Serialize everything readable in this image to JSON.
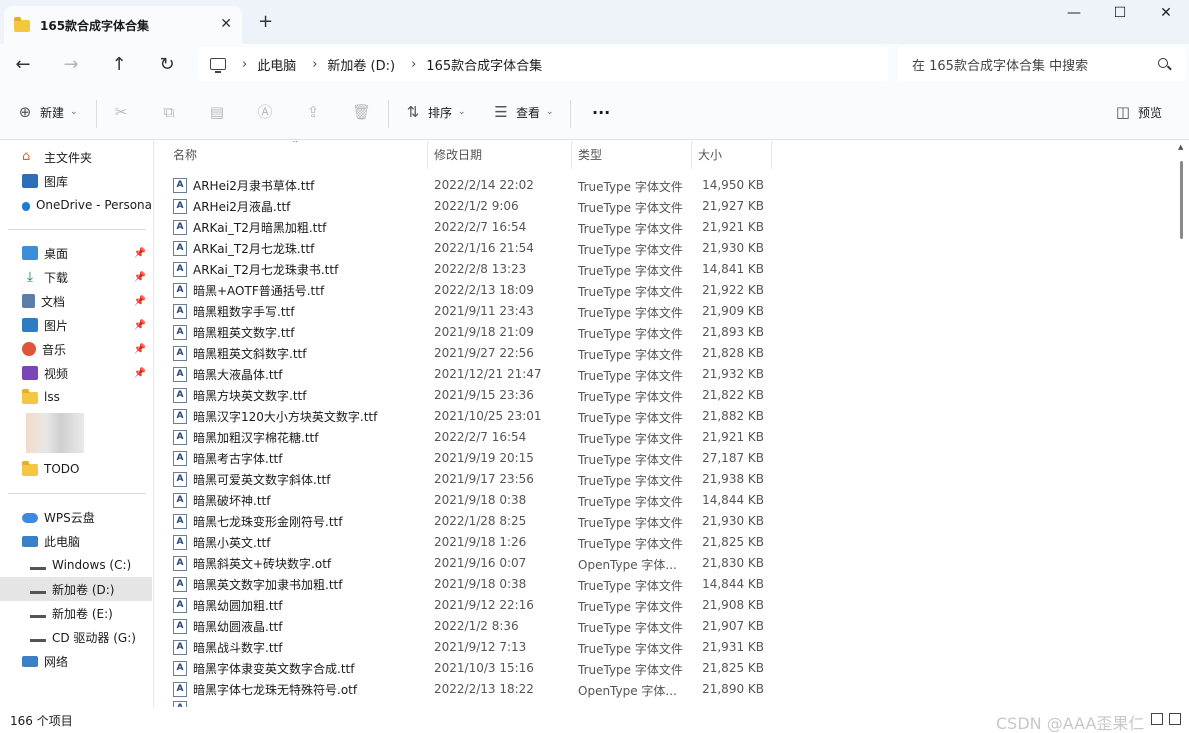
{
  "window": {
    "tab_title": "165款合成字体合集",
    "tab_close": "✕",
    "new_tab": "+",
    "minimize": "—",
    "maximize": "☐",
    "close": "✕"
  },
  "address": {
    "breadcrumbs": [
      "此电脑",
      "新加卷 (D:)",
      "165款合成字体合集"
    ],
    "search_placeholder": "在 165款合成字体合集 中搜索"
  },
  "toolbar": {
    "new_label": "新建",
    "sort_label": "排序",
    "view_label": "查看",
    "more_label": "···",
    "preview_label": "预览"
  },
  "sidebar": {
    "items": [
      {
        "label": "主文件夹",
        "icon": "home-icon"
      },
      {
        "label": "图库",
        "icon": "gallery-icon"
      },
      {
        "label": "OneDrive - Persona",
        "icon": "onedrive-icon"
      },
      {
        "label": "桌面",
        "icon": "desktop-icon",
        "pinned": true
      },
      {
        "label": "下载",
        "icon": "download-icon",
        "pinned": true
      },
      {
        "label": "文档",
        "icon": "documents-icon",
        "pinned": true
      },
      {
        "label": "图片",
        "icon": "pictures-icon",
        "pinned": true
      },
      {
        "label": "音乐",
        "icon": "music-icon",
        "pinned": true
      },
      {
        "label": "视频",
        "icon": "videos-icon",
        "pinned": true
      },
      {
        "label": "lss",
        "icon": "folder-icon"
      },
      {
        "label": "TODO",
        "icon": "folder-icon"
      },
      {
        "label": "WPS云盘",
        "icon": "wps-cloud-icon"
      },
      {
        "label": "此电脑",
        "icon": "pc-icon"
      },
      {
        "label": "Windows (C:)",
        "icon": "drive-icon"
      },
      {
        "label": "新加卷 (D:)",
        "icon": "drive-icon",
        "selected": true
      },
      {
        "label": "新加卷 (E:)",
        "icon": "drive-icon"
      },
      {
        "label": "CD 驱动器 (G:)",
        "icon": "cd-drive-icon"
      },
      {
        "label": "网络",
        "icon": "network-icon"
      }
    ]
  },
  "columns": {
    "name": "名称",
    "date": "修改日期",
    "type": "类型",
    "size": "大小"
  },
  "files": [
    {
      "name": "ARHei2月隶书草体.ttf",
      "date": "2022/2/14 22:02",
      "type": "TrueType 字体文件",
      "size": "14,950 KB"
    },
    {
      "name": "ARHei2月液晶.ttf",
      "date": "2022/1/2 9:06",
      "type": "TrueType 字体文件",
      "size": "21,927 KB"
    },
    {
      "name": "ARKai_T2月暗黑加粗.ttf",
      "date": "2022/2/7 16:54",
      "type": "TrueType 字体文件",
      "size": "21,921 KB"
    },
    {
      "name": "ARKai_T2月七龙珠.ttf",
      "date": "2022/1/16 21:54",
      "type": "TrueType 字体文件",
      "size": "21,930 KB"
    },
    {
      "name": "ARKai_T2月七龙珠隶书.ttf",
      "date": "2022/2/8 13:23",
      "type": "TrueType 字体文件",
      "size": "14,841 KB"
    },
    {
      "name": "暗黑+AOTF普通括号.ttf",
      "date": "2022/2/13 18:09",
      "type": "TrueType 字体文件",
      "size": "21,922 KB"
    },
    {
      "name": "暗黑粗数字手写.ttf",
      "date": "2021/9/11 23:43",
      "type": "TrueType 字体文件",
      "size": "21,909 KB"
    },
    {
      "name": "暗黑粗英文数字.ttf",
      "date": "2021/9/18 21:09",
      "type": "TrueType 字体文件",
      "size": "21,893 KB"
    },
    {
      "name": "暗黑粗英文斜数字.ttf",
      "date": "2021/9/27 22:56",
      "type": "TrueType 字体文件",
      "size": "21,828 KB"
    },
    {
      "name": "暗黑大液晶体.ttf",
      "date": "2021/12/21 21:47",
      "type": "TrueType 字体文件",
      "size": "21,932 KB"
    },
    {
      "name": "暗黑方块英文数字.ttf",
      "date": "2021/9/15 23:36",
      "type": "TrueType 字体文件",
      "size": "21,822 KB"
    },
    {
      "name": "暗黑汉字120大小方块英文数字.ttf",
      "date": "2021/10/25 23:01",
      "type": "TrueType 字体文件",
      "size": "21,882 KB"
    },
    {
      "name": "暗黑加粗汉字棉花糖.ttf",
      "date": "2022/2/7 16:54",
      "type": "TrueType 字体文件",
      "size": "21,921 KB"
    },
    {
      "name": "暗黑考古字体.ttf",
      "date": "2021/9/19 20:15",
      "type": "TrueType 字体文件",
      "size": "27,187 KB"
    },
    {
      "name": "暗黑可爱英文数字斜体.ttf",
      "date": "2021/9/17 23:56",
      "type": "TrueType 字体文件",
      "size": "21,938 KB"
    },
    {
      "name": "暗黑破坏神.ttf",
      "date": "2021/9/18 0:38",
      "type": "TrueType 字体文件",
      "size": "14,844 KB"
    },
    {
      "name": "暗黑七龙珠变形金刚符号.ttf",
      "date": "2022/1/28 8:25",
      "type": "TrueType 字体文件",
      "size": "21,930 KB"
    },
    {
      "name": "暗黑小英文.ttf",
      "date": "2021/9/18 1:26",
      "type": "TrueType 字体文件",
      "size": "21,825 KB"
    },
    {
      "name": "暗黑斜英文+砖块数字.otf",
      "date": "2021/9/16 0:07",
      "type": "OpenType 字体...",
      "size": "21,830 KB"
    },
    {
      "name": "暗黑英文数字加隶书加粗.ttf",
      "date": "2021/9/18 0:38",
      "type": "TrueType 字体文件",
      "size": "14,844 KB"
    },
    {
      "name": "暗黑幼圆加粗.ttf",
      "date": "2021/9/12 22:16",
      "type": "TrueType 字体文件",
      "size": "21,908 KB"
    },
    {
      "name": "暗黑幼圆液晶.ttf",
      "date": "2022/1/2 8:36",
      "type": "TrueType 字体文件",
      "size": "21,907 KB"
    },
    {
      "name": "暗黑战斗数字.ttf",
      "date": "2021/9/12 7:13",
      "type": "TrueType 字体文件",
      "size": "21,931 KB"
    },
    {
      "name": "暗黑字体隶变英文数字合成.ttf",
      "date": "2021/10/3 15:16",
      "type": "TrueType 字体文件",
      "size": "21,825 KB"
    },
    {
      "name": "暗黑字体七龙珠无特殊符号.otf",
      "date": "2022/2/13 18:22",
      "type": "OpenType 字体...",
      "size": "21,890 KB"
    }
  ],
  "status": {
    "item_count": "166 个项目",
    "watermark": "CSDN @AAA歪果仁"
  },
  "colors": {
    "folder": "#f4c642",
    "chrome": "#eef3f9",
    "selection": "#e5e5e5"
  }
}
